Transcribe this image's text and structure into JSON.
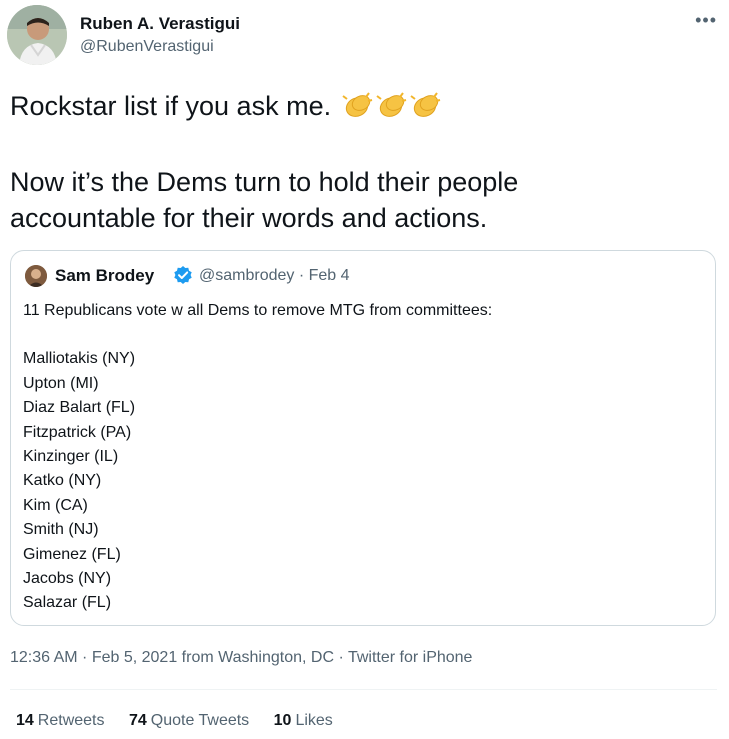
{
  "author": {
    "name": "Ruben A. Verastigui",
    "handle": "@RubenVerastigui"
  },
  "tweet": {
    "line1": "Rockstar list if you ask me.",
    "line2": "Now it’s the Dems turn to hold their people",
    "line3": "accountable for their words and actions."
  },
  "quoted": {
    "name": "Sam Brodey",
    "handle": "@sambrodey · Feb 4",
    "lead": "11 Republicans vote w all Dems to remove MTG from committees:",
    "names": [
      "Malliotakis (NY)",
      "Upton (MI)",
      "Diaz Balart (FL)",
      "Fitzpatrick (PA)",
      "Kinzinger (IL)",
      "Katko (NY)",
      "Kim (CA)",
      "Smith (NJ)",
      "Gimenez (FL)",
      "Jacobs (NY)",
      "Salazar (FL)"
    ]
  },
  "meta": {
    "time": "12:36 AM · Feb 5, 2021 from ",
    "location": "Washington, DC",
    "separator": " · ",
    "source": "Twitter for iPhone"
  },
  "stats": {
    "retweets_count": "14",
    "retweets_label": "Retweets",
    "quotes_count": "74",
    "quotes_label": "Quote Tweets",
    "likes_count": "10",
    "likes_label": "Likes"
  },
  "icons": {
    "more": "more-icon",
    "clap": "clapping-hands-icon",
    "verified": "verified-badge-icon"
  },
  "colors": {
    "text": "#0f1419",
    "secondary": "#536471",
    "border": "#cfd9de",
    "verified": "#1d9bf0",
    "clap": "#f6c343"
  }
}
